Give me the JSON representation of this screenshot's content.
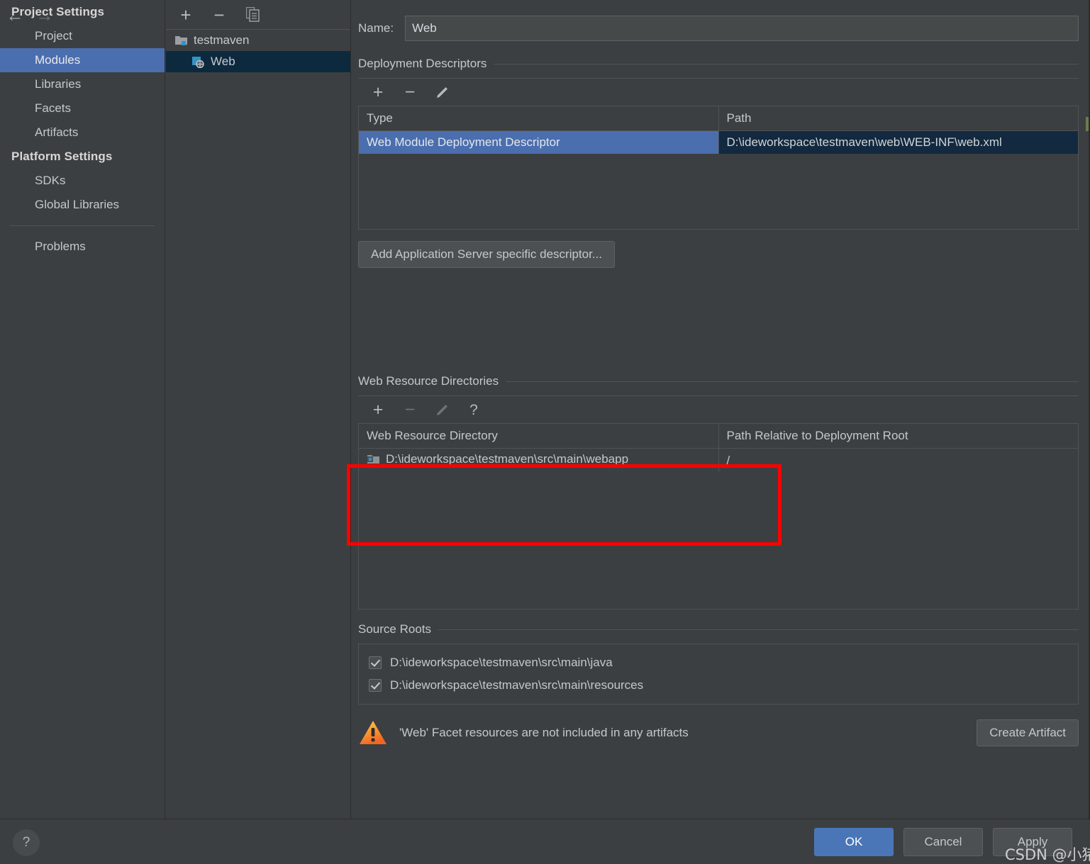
{
  "sidebar": {
    "nav": {
      "back_icon": "arrow-left-icon",
      "forward_icon": "arrow-right-icon"
    },
    "groups": [
      {
        "title": "Project Settings",
        "items": [
          {
            "label": "Project",
            "selected": false
          },
          {
            "label": "Modules",
            "selected": true
          },
          {
            "label": "Libraries",
            "selected": false
          },
          {
            "label": "Facets",
            "selected": false
          },
          {
            "label": "Artifacts",
            "selected": false
          }
        ]
      },
      {
        "title": "Platform Settings",
        "items": [
          {
            "label": "SDKs",
            "selected": false
          },
          {
            "label": "Global Libraries",
            "selected": false
          }
        ]
      }
    ],
    "problems_label": "Problems"
  },
  "tree": {
    "toolbar": [
      {
        "name": "add-module-button",
        "glyph": "+"
      },
      {
        "name": "remove-module-button",
        "glyph": "−"
      },
      {
        "name": "copy-module-button",
        "glyph": "❐"
      }
    ],
    "nodes": [
      {
        "label": "testmaven",
        "icon": "module-folder-icon",
        "selected": false
      },
      {
        "label": "Web",
        "icon": "web-facet-icon",
        "selected": true
      }
    ]
  },
  "main": {
    "name_label": "Name:",
    "name_value": "Web",
    "deployment": {
      "title": "Deployment Descriptors",
      "toolbar": [
        {
          "name": "add-descriptor-button",
          "glyph": "+",
          "enabled": true
        },
        {
          "name": "remove-descriptor-button",
          "glyph": "−",
          "enabled": true
        },
        {
          "name": "edit-descriptor-button",
          "glyph": "✎",
          "enabled": true
        }
      ],
      "columns": [
        "Type",
        "Path"
      ],
      "rows": [
        {
          "type": "Web Module Deployment Descriptor",
          "path": "D:\\ideworkspace\\testmaven\\web\\WEB-INF\\web.xml",
          "selected": true
        }
      ],
      "add_server_descriptor_label": "Add Application Server specific descriptor..."
    },
    "web_resources": {
      "title": "Web Resource Directories",
      "toolbar": [
        {
          "name": "add-web-resource-button",
          "glyph": "+",
          "enabled": true
        },
        {
          "name": "remove-web-resource-button",
          "glyph": "−",
          "enabled": false
        },
        {
          "name": "edit-web-resource-button",
          "glyph": "✎",
          "enabled": false
        },
        {
          "name": "help-web-resource-button",
          "glyph": "?",
          "enabled": true
        }
      ],
      "columns": [
        "Web Resource Directory",
        "Path Relative to Deployment Root"
      ],
      "rows": [
        {
          "directory": "D:\\ideworkspace\\testmaven\\src\\main\\webapp",
          "relative_path": "/",
          "icon": "folder-resource-icon"
        }
      ]
    },
    "source_roots": {
      "title": "Source Roots",
      "items": [
        {
          "path": "D:\\ideworkspace\\testmaven\\src\\main\\java",
          "checked": true
        },
        {
          "path": "D:\\ideworkspace\\testmaven\\src\\main\\resources",
          "checked": true
        }
      ]
    },
    "warning": {
      "icon": "warning-triangle-icon",
      "text": "'Web' Facet resources are not included in any artifacts",
      "action_label": "Create Artifact"
    }
  },
  "bottom": {
    "help_label": "?",
    "ok_label": "OK",
    "cancel_label": "Cancel",
    "apply_label": "Apply"
  },
  "watermark": "CSDN @小猪弟",
  "colors": {
    "selection_blue": "#4b6eaf",
    "ok_button_blue": "#4a76b8",
    "annotation_red": "#ff0000",
    "panel_bg": "#3c3f41",
    "tree_selected": "#0d293e",
    "path_cell_bg": "#12293f"
  }
}
